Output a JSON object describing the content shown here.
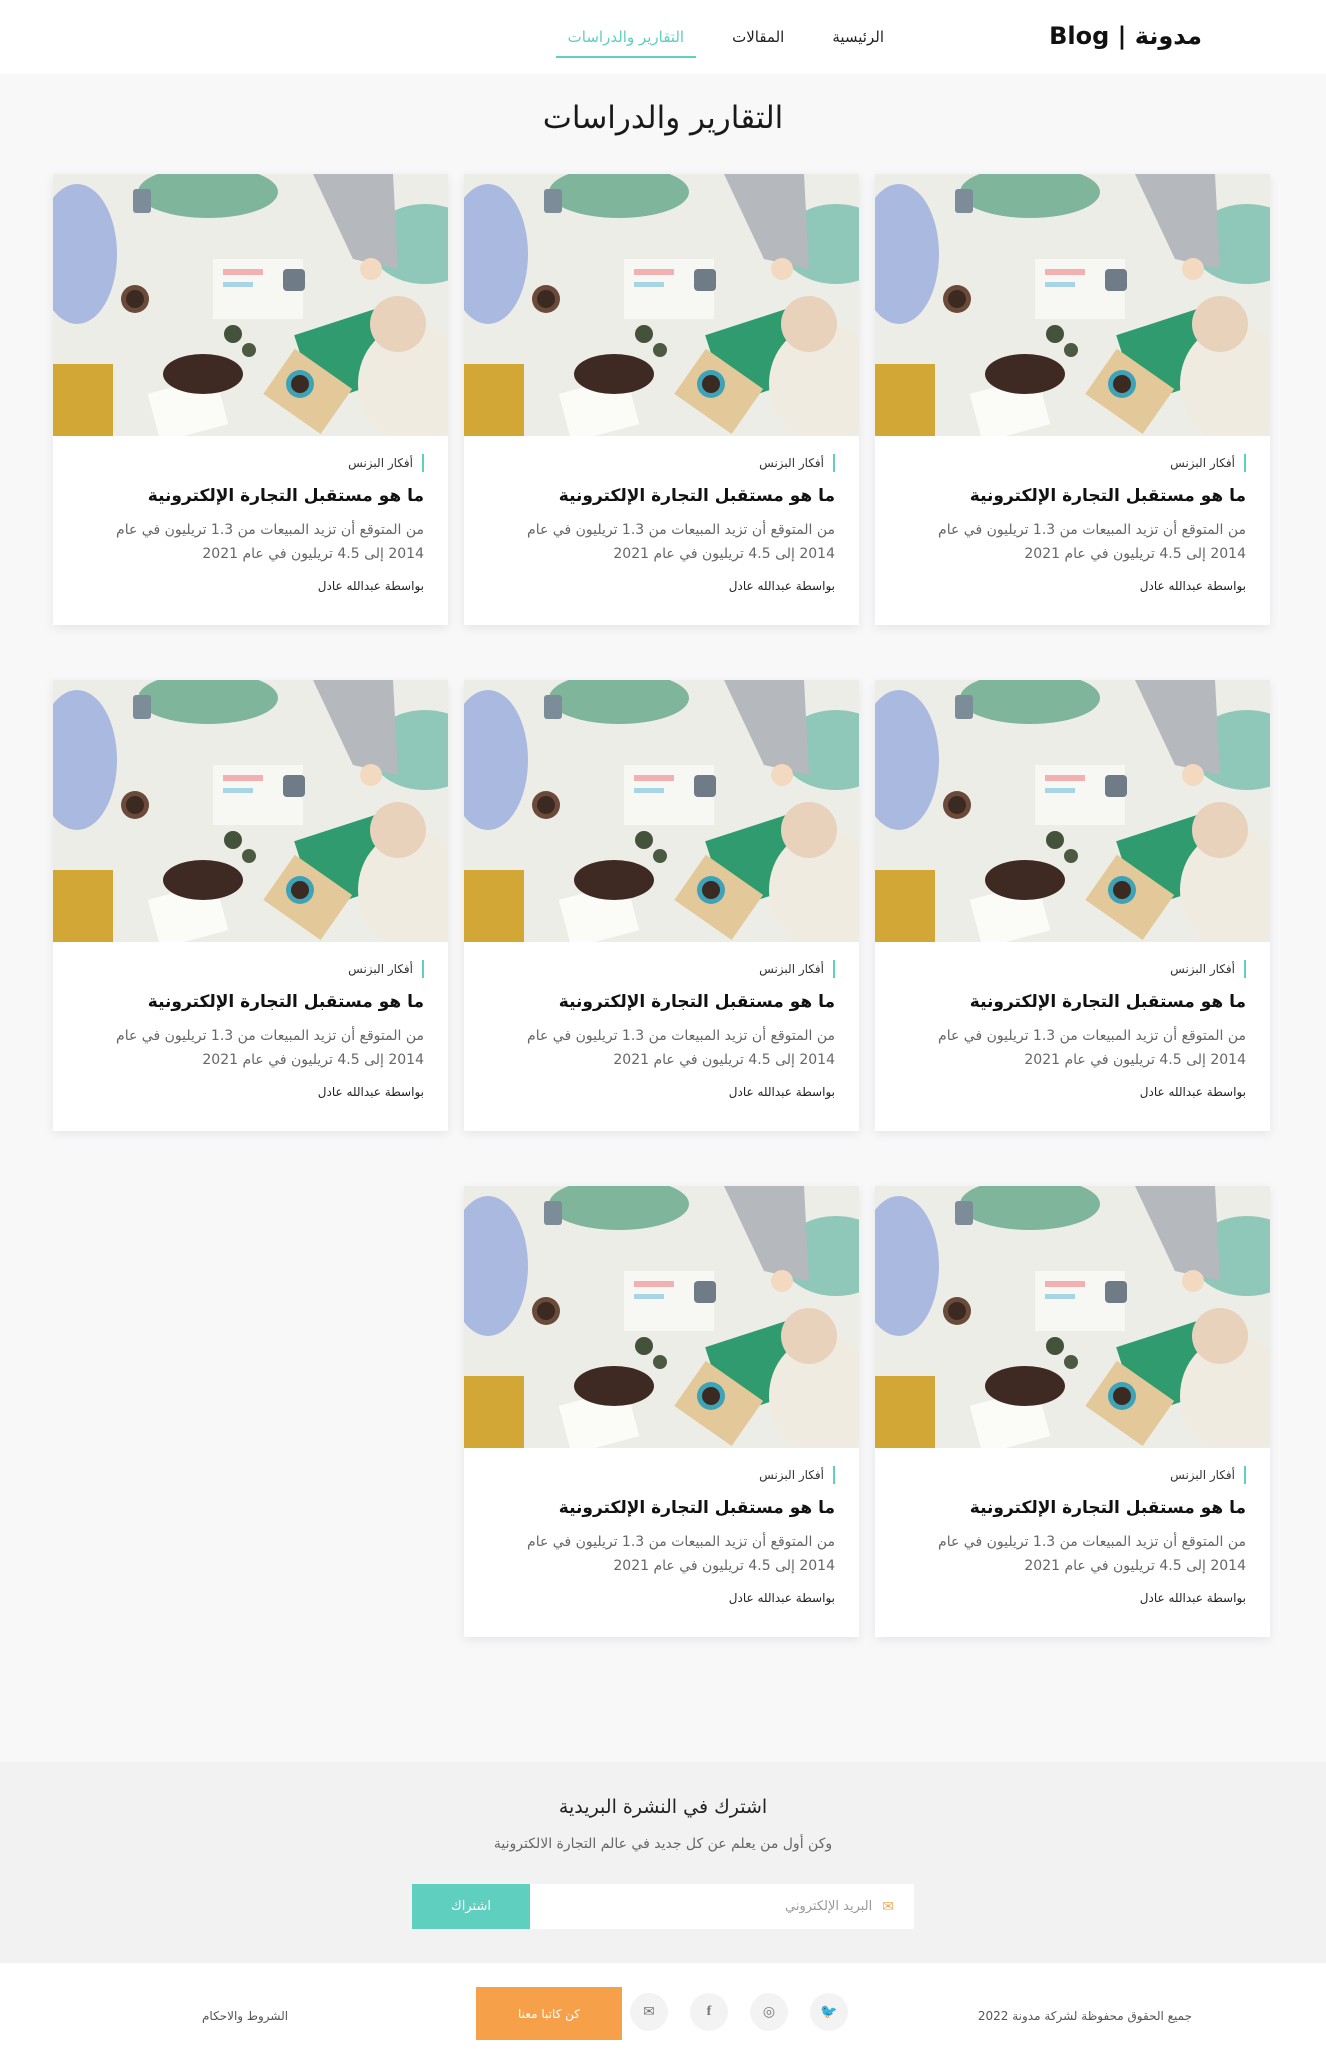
{
  "header": {
    "logo": "مدونة | Blog",
    "nav": [
      {
        "label": "الرئيسية",
        "active": false
      },
      {
        "label": "المقالات",
        "active": false
      },
      {
        "label": "التقارير والدراسات",
        "active": true
      }
    ]
  },
  "page_title": "التقارير والدراسات",
  "cards": [
    {
      "category": "أفكار البزنس",
      "title": "ما هو مستقبل التجارة الإلكترونية",
      "excerpt": "من المتوقع أن تزيد المبيعات من 1.3 تريليون في عام 2014 إلى 4.5 تريليون في عام 2021",
      "author": "بواسطة عبدالله عادل"
    },
    {
      "category": "أفكار البزنس",
      "title": "ما هو مستقبل التجارة الإلكترونية",
      "excerpt": "من المتوقع أن تزيد المبيعات من 1.3 تريليون في عام 2014 إلى 4.5 تريليون في عام 2021",
      "author": "بواسطة عبدالله عادل"
    },
    {
      "category": "أفكار البزنس",
      "title": "ما هو مستقبل التجارة الإلكترونية",
      "excerpt": "من المتوقع أن تزيد المبيعات من 1.3 تريليون في عام 2014 إلى 4.5 تريليون في عام 2021",
      "author": "بواسطة عبدالله عادل"
    },
    {
      "category": "أفكار البزنس",
      "title": "ما هو مستقبل التجارة الإلكترونية",
      "excerpt": "من المتوقع أن تزيد المبيعات من 1.3 تريليون في عام 2014 إلى 4.5 تريليون في عام 2021",
      "author": "بواسطة عبدالله عادل"
    },
    {
      "category": "أفكار البزنس",
      "title": "ما هو مستقبل التجارة الإلكترونية",
      "excerpt": "من المتوقع أن تزيد المبيعات من 1.3 تريليون في عام 2014 إلى 4.5 تريليون في عام 2021",
      "author": "بواسطة عبدالله عادل"
    },
    {
      "category": "أفكار البزنس",
      "title": "ما هو مستقبل التجارة الإلكترونية",
      "excerpt": "من المتوقع أن تزيد المبيعات من 1.3 تريليون في عام 2014 إلى 4.5 تريليون في عام 2021",
      "author": "بواسطة عبدالله عادل"
    },
    {
      "category": "أفكار البزنس",
      "title": "ما هو مستقبل التجارة الإلكترونية",
      "excerpt": "من المتوقع أن تزيد المبيعات من 1.3 تريليون في عام 2014 إلى 4.5 تريليون في عام 2021",
      "author": "بواسطة عبدالله عادل"
    },
    {
      "category": "أفكار البزنس",
      "title": "ما هو مستقبل التجارة الإلكترونية",
      "excerpt": "من المتوقع أن تزيد المبيعات من 1.3 تريليون في عام 2014 إلى 4.5 تريليون في عام 2021",
      "author": "بواسطة عبدالله عادل"
    }
  ],
  "newsletter": {
    "title": "اشترك في النشرة البريدية",
    "subtitle": "وكن أول من يعلم عن كل جديد في عالم التجارة الالكترونية",
    "email_placeholder": "البريد الإلكتروني",
    "subscribe_label": "اشتراك"
  },
  "footer": {
    "copyright": "جميع الحقوق محفوظة لشركة مدونة 2022",
    "contact_label": "كن كاتبا معنا",
    "terms_label": "الشروط والاحكام",
    "socials": [
      "email-icon",
      "facebook-icon",
      "instagram-icon",
      "twitter-icon"
    ]
  },
  "colors": {
    "accent": "#5fcfbf",
    "contact": "#f7a04a"
  }
}
